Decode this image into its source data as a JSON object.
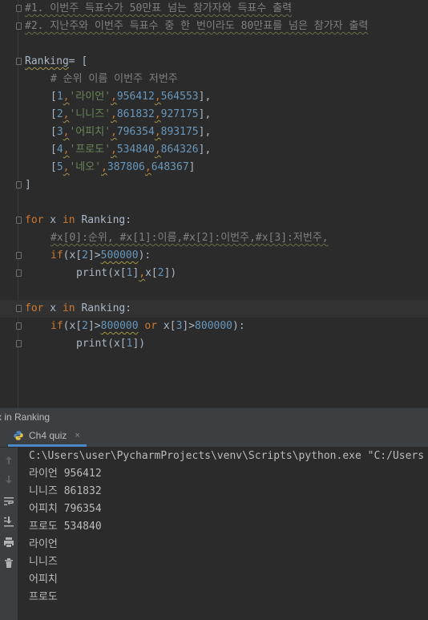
{
  "editor": {
    "lines": [
      {
        "tokens": [
          {
            "t": "#1. 이번주 득표수가 50만표 넘는 참가자와 득표수 출력",
            "c": "comment",
            "u": "grey"
          }
        ],
        "fold": true,
        "indent": 0
      },
      {
        "tokens": [
          {
            "t": "#2. 지난주와 이번주 득표수 중 한 번이라도 80만표를 넘은 참가자 출력",
            "c": "comment",
            "u": "grey"
          }
        ],
        "fold": true,
        "indent": 0
      },
      {
        "tokens": [],
        "indent": 0
      },
      {
        "tokens": [
          {
            "t": "Ranking",
            "c": "text",
            "u": "wavy"
          },
          {
            "t": "= [",
            "c": "text"
          }
        ],
        "fold": true,
        "indent": 0
      },
      {
        "tokens": [
          {
            "t": "# 순위 이름 이번주 저번주",
            "c": "comment"
          }
        ],
        "indent": 1
      },
      {
        "tokens": [
          {
            "t": "[",
            "c": "text"
          },
          {
            "t": "1",
            "c": "num"
          },
          {
            "t": ",",
            "c": "kw",
            "u": "wavy"
          },
          {
            "t": "'라이언'",
            "c": "str"
          },
          {
            "t": ",",
            "c": "kw",
            "u": "wavy"
          },
          {
            "t": "956412",
            "c": "num"
          },
          {
            "t": ",",
            "c": "kw",
            "u": "wavy"
          },
          {
            "t": "564553",
            "c": "num"
          },
          {
            "t": "],",
            "c": "text"
          }
        ],
        "indent": 1
      },
      {
        "tokens": [
          {
            "t": "[",
            "c": "text"
          },
          {
            "t": "2",
            "c": "num"
          },
          {
            "t": ",",
            "c": "kw",
            "u": "wavy"
          },
          {
            "t": "'니니즈'",
            "c": "str"
          },
          {
            "t": ",",
            "c": "kw",
            "u": "wavy"
          },
          {
            "t": "861832",
            "c": "num"
          },
          {
            "t": ",",
            "c": "kw",
            "u": "wavy"
          },
          {
            "t": "927175",
            "c": "num"
          },
          {
            "t": "],",
            "c": "text"
          }
        ],
        "indent": 1
      },
      {
        "tokens": [
          {
            "t": "[",
            "c": "text"
          },
          {
            "t": "3",
            "c": "num"
          },
          {
            "t": ",",
            "c": "kw",
            "u": "wavy"
          },
          {
            "t": "'어피치'",
            "c": "str"
          },
          {
            "t": ",",
            "c": "kw",
            "u": "wavy"
          },
          {
            "t": "796354",
            "c": "num"
          },
          {
            "t": ",",
            "c": "kw",
            "u": "wavy"
          },
          {
            "t": "893175",
            "c": "num"
          },
          {
            "t": "],",
            "c": "text"
          }
        ],
        "indent": 1
      },
      {
        "tokens": [
          {
            "t": "[",
            "c": "text"
          },
          {
            "t": "4",
            "c": "num"
          },
          {
            "t": ",",
            "c": "kw",
            "u": "wavy"
          },
          {
            "t": "'프로도'",
            "c": "str"
          },
          {
            "t": ",",
            "c": "kw",
            "u": "wavy"
          },
          {
            "t": "534840",
            "c": "num"
          },
          {
            "t": ",",
            "c": "kw",
            "u": "wavy"
          },
          {
            "t": "864326",
            "c": "num"
          },
          {
            "t": "],",
            "c": "text"
          }
        ],
        "indent": 1
      },
      {
        "tokens": [
          {
            "t": "[",
            "c": "text"
          },
          {
            "t": "5",
            "c": "num"
          },
          {
            "t": ",",
            "c": "kw",
            "u": "wavy"
          },
          {
            "t": "'네오'",
            "c": "str"
          },
          {
            "t": ",",
            "c": "kw",
            "u": "wavy"
          },
          {
            "t": "387806",
            "c": "num"
          },
          {
            "t": ",",
            "c": "kw",
            "u": "wavy"
          },
          {
            "t": "648367",
            "c": "num"
          },
          {
            "t": "]",
            "c": "text"
          }
        ],
        "indent": 1
      },
      {
        "tokens": [
          {
            "t": "]",
            "c": "text"
          }
        ],
        "fold": true,
        "indent": 0
      },
      {
        "tokens": [],
        "indent": 0
      },
      {
        "tokens": [
          {
            "t": "for",
            "c": "kw"
          },
          {
            "t": " x ",
            "c": "text"
          },
          {
            "t": "in",
            "c": "kw"
          },
          {
            "t": " Ranking:",
            "c": "text"
          }
        ],
        "fold": true,
        "indent": 0
      },
      {
        "tokens": [
          {
            "t": "#x[0]:순위, #x[1]:이름,#x[2]:이번주,#x[3]:저번주,",
            "c": "comment",
            "u": "grey"
          }
        ],
        "indent": 1
      },
      {
        "tokens": [
          {
            "t": "if",
            "c": "kw"
          },
          {
            "t": "(x[",
            "c": "text"
          },
          {
            "t": "2",
            "c": "num"
          },
          {
            "t": "]>",
            "c": "text"
          },
          {
            "t": "500000",
            "c": "num",
            "u": "wavy"
          },
          {
            "t": "):",
            "c": "text"
          }
        ],
        "fold": true,
        "indent": 1
      },
      {
        "tokens": [
          {
            "t": "print",
            "c": "text"
          },
          {
            "t": "(x[",
            "c": "text"
          },
          {
            "t": "1",
            "c": "num"
          },
          {
            "t": "]",
            "c": "text"
          },
          {
            "t": ",",
            "c": "kw",
            "u": "wavy"
          },
          {
            "t": "x[",
            "c": "text"
          },
          {
            "t": "2",
            "c": "num"
          },
          {
            "t": "])",
            "c": "text"
          }
        ],
        "fold": true,
        "indent": 2
      },
      {
        "tokens": [],
        "indent": 0
      },
      {
        "tokens": [
          {
            "t": "for",
            "c": "kw"
          },
          {
            "t": " x ",
            "c": "text"
          },
          {
            "t": "in",
            "c": "kw"
          },
          {
            "t": " Ranking:",
            "c": "text"
          }
        ],
        "fold": true,
        "indent": 0,
        "highlight": true
      },
      {
        "tokens": [
          {
            "t": "if",
            "c": "kw"
          },
          {
            "t": "(x[",
            "c": "text"
          },
          {
            "t": "2",
            "c": "num"
          },
          {
            "t": "]>",
            "c": "text"
          },
          {
            "t": "800000",
            "c": "num",
            "u": "wavy"
          },
          {
            "t": " ",
            "c": "text"
          },
          {
            "t": "or",
            "c": "kw"
          },
          {
            "t": " x[",
            "c": "text"
          },
          {
            "t": "3",
            "c": "num"
          },
          {
            "t": "]>",
            "c": "text"
          },
          {
            "t": "800000",
            "c": "num"
          },
          {
            "t": "):",
            "c": "text"
          }
        ],
        "fold": true,
        "indent": 1
      },
      {
        "tokens": [
          {
            "t": "print",
            "c": "text"
          },
          {
            "t": "(x[",
            "c": "text"
          },
          {
            "t": "1",
            "c": "num"
          },
          {
            "t": "])",
            "c": "text"
          }
        ],
        "fold": true,
        "indent": 2
      }
    ]
  },
  "breadcrumb": {
    "text": "x in Ranking"
  },
  "run": {
    "tab_label": "Ch4 quiz",
    "close_glyph": "×",
    "output": [
      "C:\\Users\\user\\PycharmProjects\\venv\\Scripts\\python.exe \"C:/Users",
      "라이언 956412",
      "니니즈 861832",
      "어피치 796354",
      "프로도 534840",
      "라이언",
      "니니즈",
      "어피치",
      "프로도"
    ]
  },
  "icons": {
    "toolbar": [
      "arrow-up-icon",
      "arrow-down-icon",
      "soft-wrap-icon",
      "scroll-to-end-icon",
      "print-icon",
      "trash-icon"
    ]
  },
  "colors": {
    "editor_bg": "#2b2b2b",
    "keyword": "#cc7832",
    "number": "#6897bb",
    "string": "#6a8759",
    "comment": "#808080",
    "text": "#a9b7c6",
    "active_tab_underline": "#4a88c7"
  }
}
